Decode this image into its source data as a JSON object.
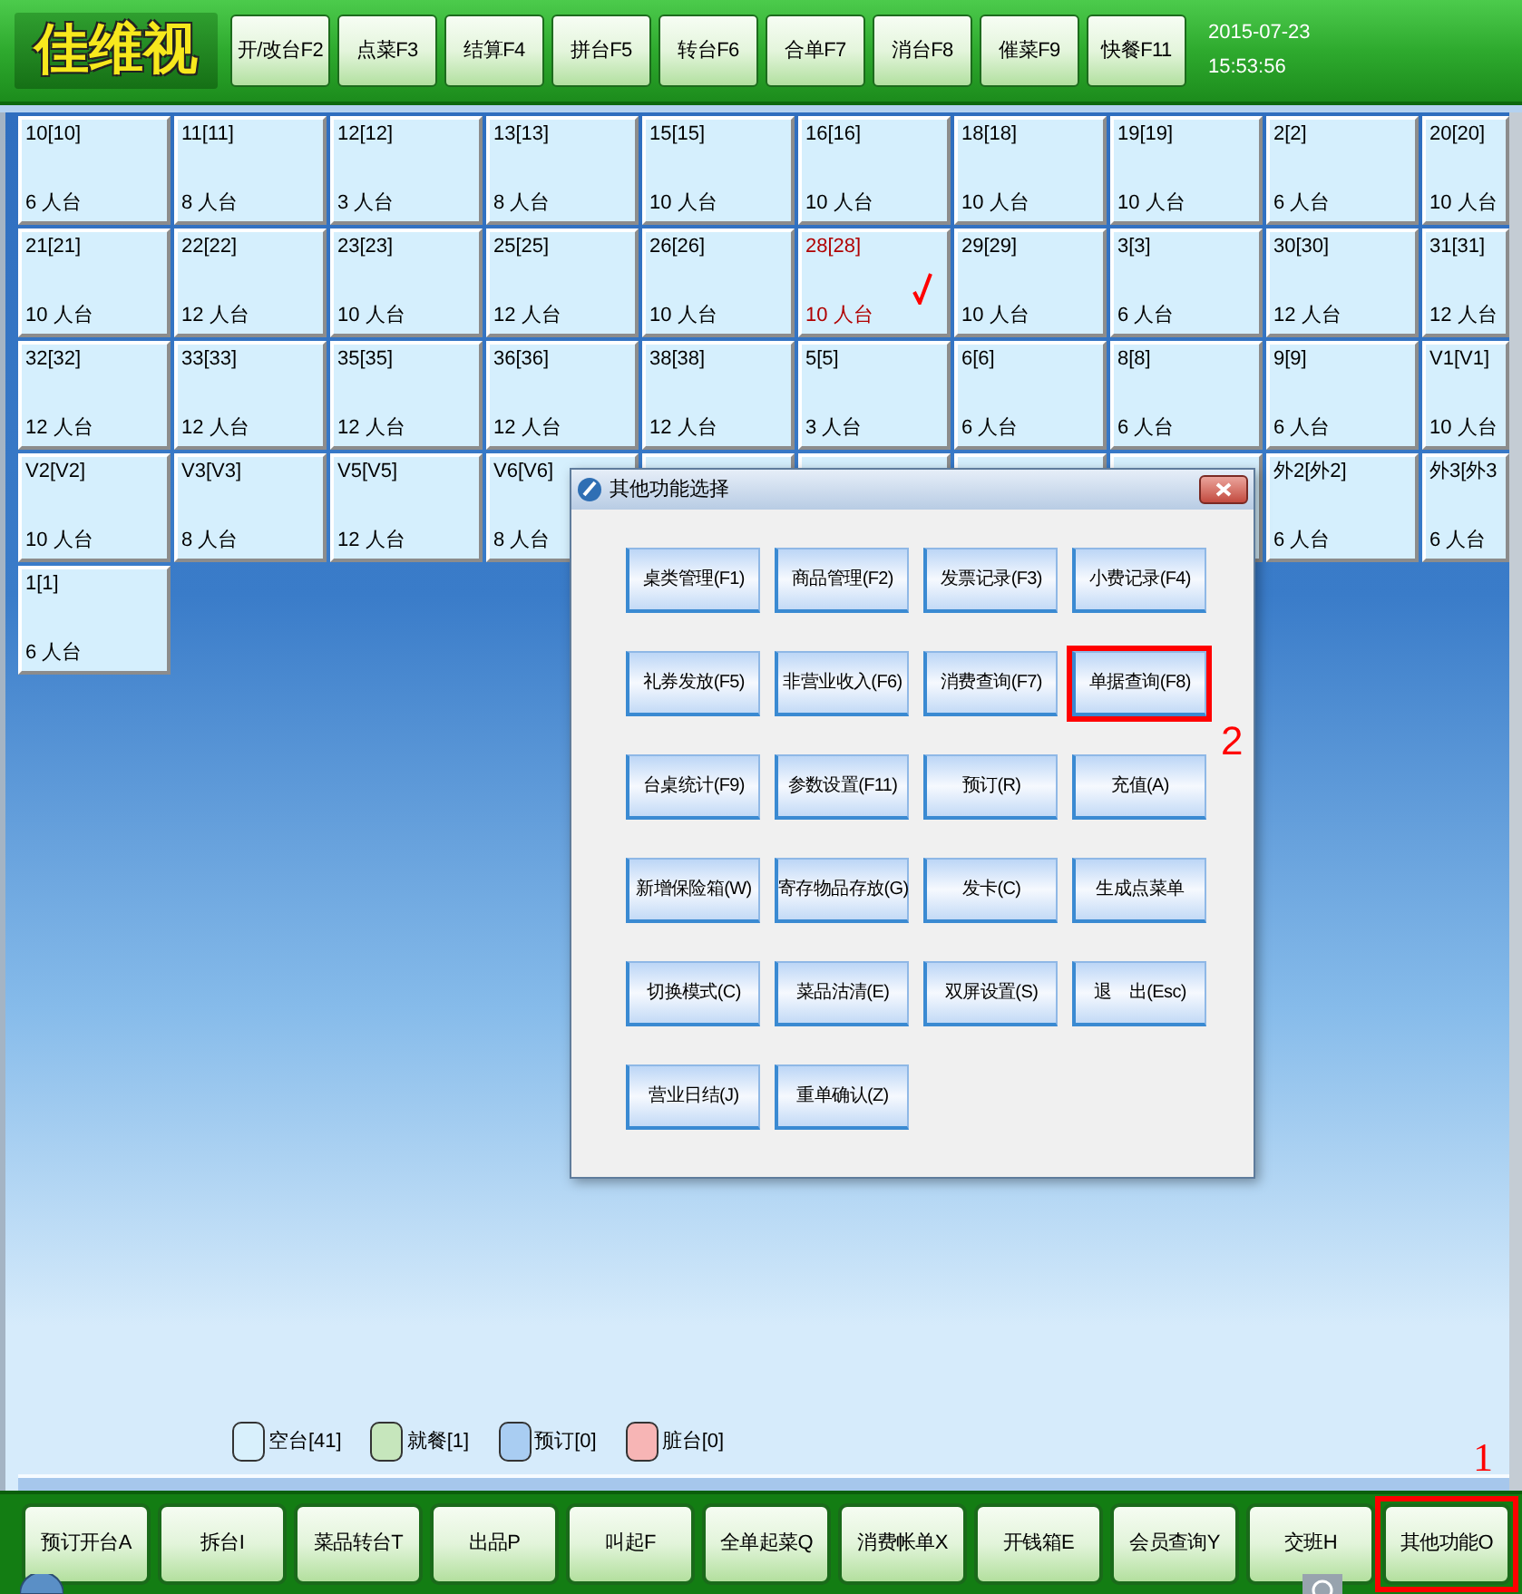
{
  "header": {
    "logo": "佳维视",
    "buttons": [
      "开/改台F2",
      "点菜F3",
      "结算F4",
      "拼台F5",
      "转台F6",
      "合单F7",
      "消台F8",
      "催菜F9",
      "快餐F11"
    ],
    "date": "2015-07-23",
    "time": "15:53:56"
  },
  "tables": [
    {
      "name": "10[10]",
      "capacity": "6 人台",
      "selected": false
    },
    {
      "name": "11[11]",
      "capacity": "8 人台",
      "selected": false
    },
    {
      "name": "12[12]",
      "capacity": "3 人台",
      "selected": false
    },
    {
      "name": "13[13]",
      "capacity": "8 人台",
      "selected": false
    },
    {
      "name": "15[15]",
      "capacity": "10 人台",
      "selected": false
    },
    {
      "name": "16[16]",
      "capacity": "10 人台",
      "selected": false
    },
    {
      "name": "18[18]",
      "capacity": "10 人台",
      "selected": false
    },
    {
      "name": "19[19]",
      "capacity": "10 人台",
      "selected": false
    },
    {
      "name": "2[2]",
      "capacity": "6 人台",
      "selected": false
    },
    {
      "name": "20[20]",
      "capacity": "10 人台",
      "selected": false
    },
    {
      "name": "21[21]",
      "capacity": "10 人台",
      "selected": false
    },
    {
      "name": "22[22]",
      "capacity": "12 人台",
      "selected": false
    },
    {
      "name": "23[23]",
      "capacity": "10 人台",
      "selected": false
    },
    {
      "name": "25[25]",
      "capacity": "12 人台",
      "selected": false
    },
    {
      "name": "26[26]",
      "capacity": "10 人台",
      "selected": false
    },
    {
      "name": "28[28]",
      "capacity": "10 人台",
      "selected": true
    },
    {
      "name": "29[29]",
      "capacity": "10 人台",
      "selected": false
    },
    {
      "name": "3[3]",
      "capacity": "6 人台",
      "selected": false
    },
    {
      "name": "30[30]",
      "capacity": "12 人台",
      "selected": false
    },
    {
      "name": "31[31]",
      "capacity": "12 人台",
      "selected": false
    },
    {
      "name": "32[32]",
      "capacity": "12 人台",
      "selected": false
    },
    {
      "name": "33[33]",
      "capacity": "12 人台",
      "selected": false
    },
    {
      "name": "35[35]",
      "capacity": "12 人台",
      "selected": false
    },
    {
      "name": "36[36]",
      "capacity": "12 人台",
      "selected": false
    },
    {
      "name": "38[38]",
      "capacity": "12 人台",
      "selected": false
    },
    {
      "name": "5[5]",
      "capacity": "3 人台",
      "selected": false
    },
    {
      "name": "6[6]",
      "capacity": "6 人台",
      "selected": false
    },
    {
      "name": "8[8]",
      "capacity": "6 人台",
      "selected": false
    },
    {
      "name": "9[9]",
      "capacity": "6 人台",
      "selected": false
    },
    {
      "name": "V1[V1]",
      "capacity": "10 人台",
      "selected": false
    },
    {
      "name": "V2[V2]",
      "capacity": "10 人台",
      "selected": false
    },
    {
      "name": "V3[V3]",
      "capacity": "8 人台",
      "selected": false
    },
    {
      "name": "V5[V5]",
      "capacity": "12 人台",
      "selected": false
    },
    {
      "name": "V6[V6]",
      "capacity": "8 人台",
      "selected": false
    },
    {
      "selected": false
    },
    {
      "selected": false
    },
    {
      "selected": false
    },
    {
      "selected": false
    },
    {
      "name": "外2[外2]",
      "capacity": "6 人台",
      "selected": false
    },
    {
      "name": "外3[外3",
      "capacity": "6 人台",
      "selected": false
    },
    {
      "name": "1[1]",
      "capacity": "6 人台",
      "selected": false
    }
  ],
  "legend": [
    {
      "label": "空台[41]",
      "color": "#d8f0fc"
    },
    {
      "label": "就餐[1]",
      "color": "#c6e6bc"
    },
    {
      "label": "预订[0]",
      "color": "#a9cdf2"
    },
    {
      "label": "脏台[0]",
      "color": "#f7b5b5"
    }
  ],
  "function_bar": [
    {
      "label": "预订开台A",
      "marked": false
    },
    {
      "label": "拆台I",
      "marked": false
    },
    {
      "label": "菜品转台T",
      "marked": false
    },
    {
      "label": "出品P",
      "marked": false
    },
    {
      "label": "叫起F",
      "marked": false
    },
    {
      "label": "全单起菜Q",
      "marked": false
    },
    {
      "label": "消费帐单X",
      "marked": false
    },
    {
      "label": "开钱箱E",
      "marked": false
    },
    {
      "label": "会员查询Y",
      "marked": false
    },
    {
      "label": "交班H",
      "marked": false
    },
    {
      "label": "其他功能O",
      "marked": true,
      "callout": "1"
    }
  ],
  "dialog": {
    "title": "其他功能选择",
    "buttons": [
      {
        "label": "桌类管理(F1)",
        "marked": false
      },
      {
        "label": "商品管理(F2)",
        "marked": false
      },
      {
        "label": "发票记录(F3)",
        "marked": false
      },
      {
        "label": "小费记录(F4)",
        "marked": false
      },
      {
        "label": "礼券发放(F5)",
        "marked": false
      },
      {
        "label": "非营业收入(F6)",
        "marked": false
      },
      {
        "label": "消费查询(F7)",
        "marked": false
      },
      {
        "label": "单据查询(F8)",
        "marked": true,
        "callout": "2"
      },
      {
        "label": "台桌统计(F9)",
        "marked": false
      },
      {
        "label": "参数设置(F11)",
        "marked": false
      },
      {
        "label": "预订(R)",
        "marked": false
      },
      {
        "label": "充值(A)",
        "marked": false
      },
      {
        "label": "新增保险箱(W)",
        "marked": false
      },
      {
        "label": "寄存物品存放(G)",
        "marked": false
      },
      {
        "label": "发卡(C)",
        "marked": false
      },
      {
        "label": "生成点菜单",
        "marked": false
      },
      {
        "label": "切换模式(C)",
        "marked": false
      },
      {
        "label": "菜品沽清(E)",
        "marked": false
      },
      {
        "label": "双屏设置(S)",
        "marked": false
      },
      {
        "label": "退　出(Esc)",
        "marked": false
      },
      {
        "label": "营业日结(J)",
        "marked": false
      },
      {
        "label": "重单确认(Z)",
        "marked": false
      }
    ]
  }
}
